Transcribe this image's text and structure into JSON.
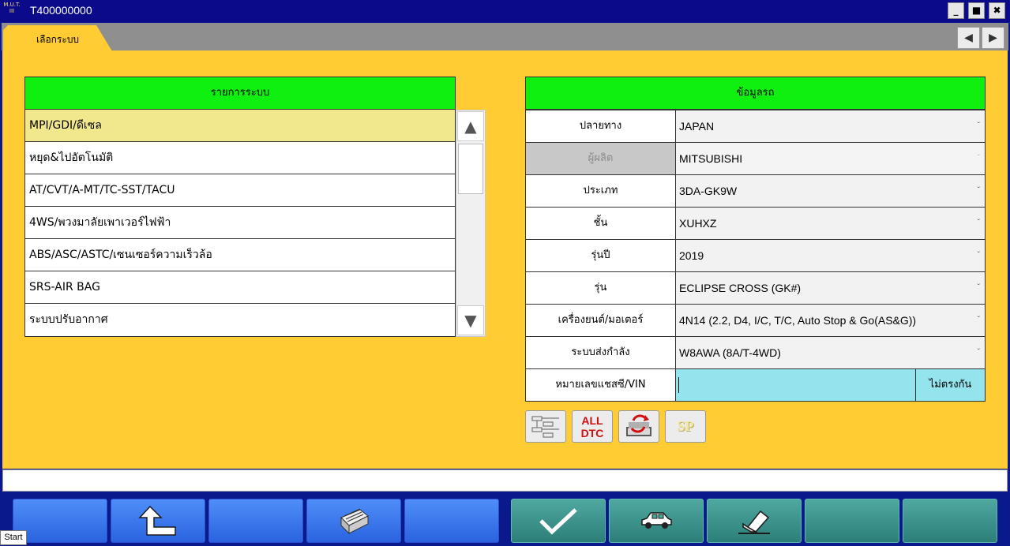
{
  "window": {
    "title": "T400000000",
    "logo_text": "M.U.T. III"
  },
  "tab": {
    "label": "เลือกระบบ"
  },
  "system_list": {
    "header": "รายการระบบ",
    "items": [
      "MPI/GDI/ดีเซล",
      "หยุด&ไปอัตโนมัติ",
      "AT/CVT/A-MT/TC-SST/TACU",
      "4WS/พวงมาลัยเพาเวอร์ไฟฟ้า",
      "ABS/ASC/ASTC/เซนเซอร์ความเร็วล้อ",
      "SRS-AIR BAG",
      "ระบบปรับอากาศ"
    ],
    "selected_index": 0
  },
  "vehicle_info": {
    "header": "ข้อมูลรถ",
    "fields": [
      {
        "label": "ปลายทาง",
        "value": "JAPAN"
      },
      {
        "label": "ผู้ผลิต",
        "value": "MITSUBISHI"
      },
      {
        "label": "ประเภท",
        "value": "3DA-GK9W"
      },
      {
        "label": "ชั้น",
        "value": "XUHXZ"
      },
      {
        "label": "รุ่นปี",
        "value": "2019"
      },
      {
        "label": "รุ่น",
        "value": "ECLIPSE CROSS (GK#)"
      },
      {
        "label": "เครื่องยนต์/มอเตอร์",
        "value": "4N14 (2.2, D4, I/C, T/C, Auto Stop & Go(AS&G))"
      },
      {
        "label": "ระบบส่งกำลัง",
        "value": "W8AWA (8A/T-4WD)"
      }
    ],
    "vin_label": "หมายเลขแชสซี/VIN",
    "vin_value": "",
    "vin_status": "ไม่ตรงกัน"
  },
  "tool_buttons": {
    "all_dtc_line1": "ALL",
    "all_dtc_line2": "DTC",
    "sp_label": "SP"
  },
  "taskbar_tooltip": "Start",
  "colors": {
    "panel_bg": "#ffcc33",
    "header_green": "#10f010",
    "selected_row": "#f1e88e",
    "vin_bg": "#94e4ee",
    "title_bar": "#0a0a8a"
  }
}
